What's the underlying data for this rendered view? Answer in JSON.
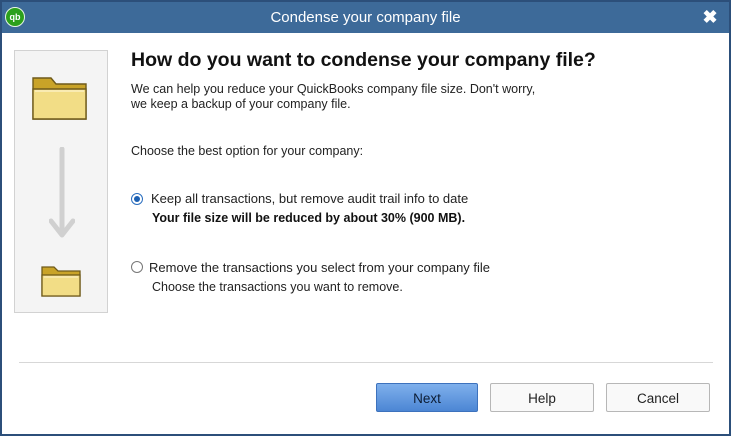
{
  "window": {
    "title": "Condense your company file",
    "app_logo_text": "qb",
    "close_glyph": "✖"
  },
  "icons": {
    "app": "quickbooks-logo-icon",
    "close": "close-icon",
    "folder_large": "folder-icon",
    "arrow_down": "arrow-down-icon",
    "folder_small": "folder-icon"
  },
  "main": {
    "heading": "How do you want to condense your company file?",
    "description_line1": "We can help you reduce your QuickBooks company file size. Don't worry,",
    "description_line2": "we keep a backup of your company file.",
    "choose_label": "Choose the best option for your company:"
  },
  "options": [
    {
      "label": "Keep all transactions, but remove audit trail info to date",
      "detail": "Your file size will be reduced by about 30% (900 MB).",
      "selected": true
    },
    {
      "label": "Remove the transactions you select from your company file",
      "detail": "Choose the transactions you want to remove.",
      "selected": false
    }
  ],
  "buttons": {
    "next": "Next",
    "help": "Help",
    "cancel": "Cancel"
  },
  "colors": {
    "titlebar": "#3d6a99",
    "qb_green": "#2ca01c",
    "primary_button": "#5b93dc",
    "radio_selected": "#1b5fb2"
  }
}
